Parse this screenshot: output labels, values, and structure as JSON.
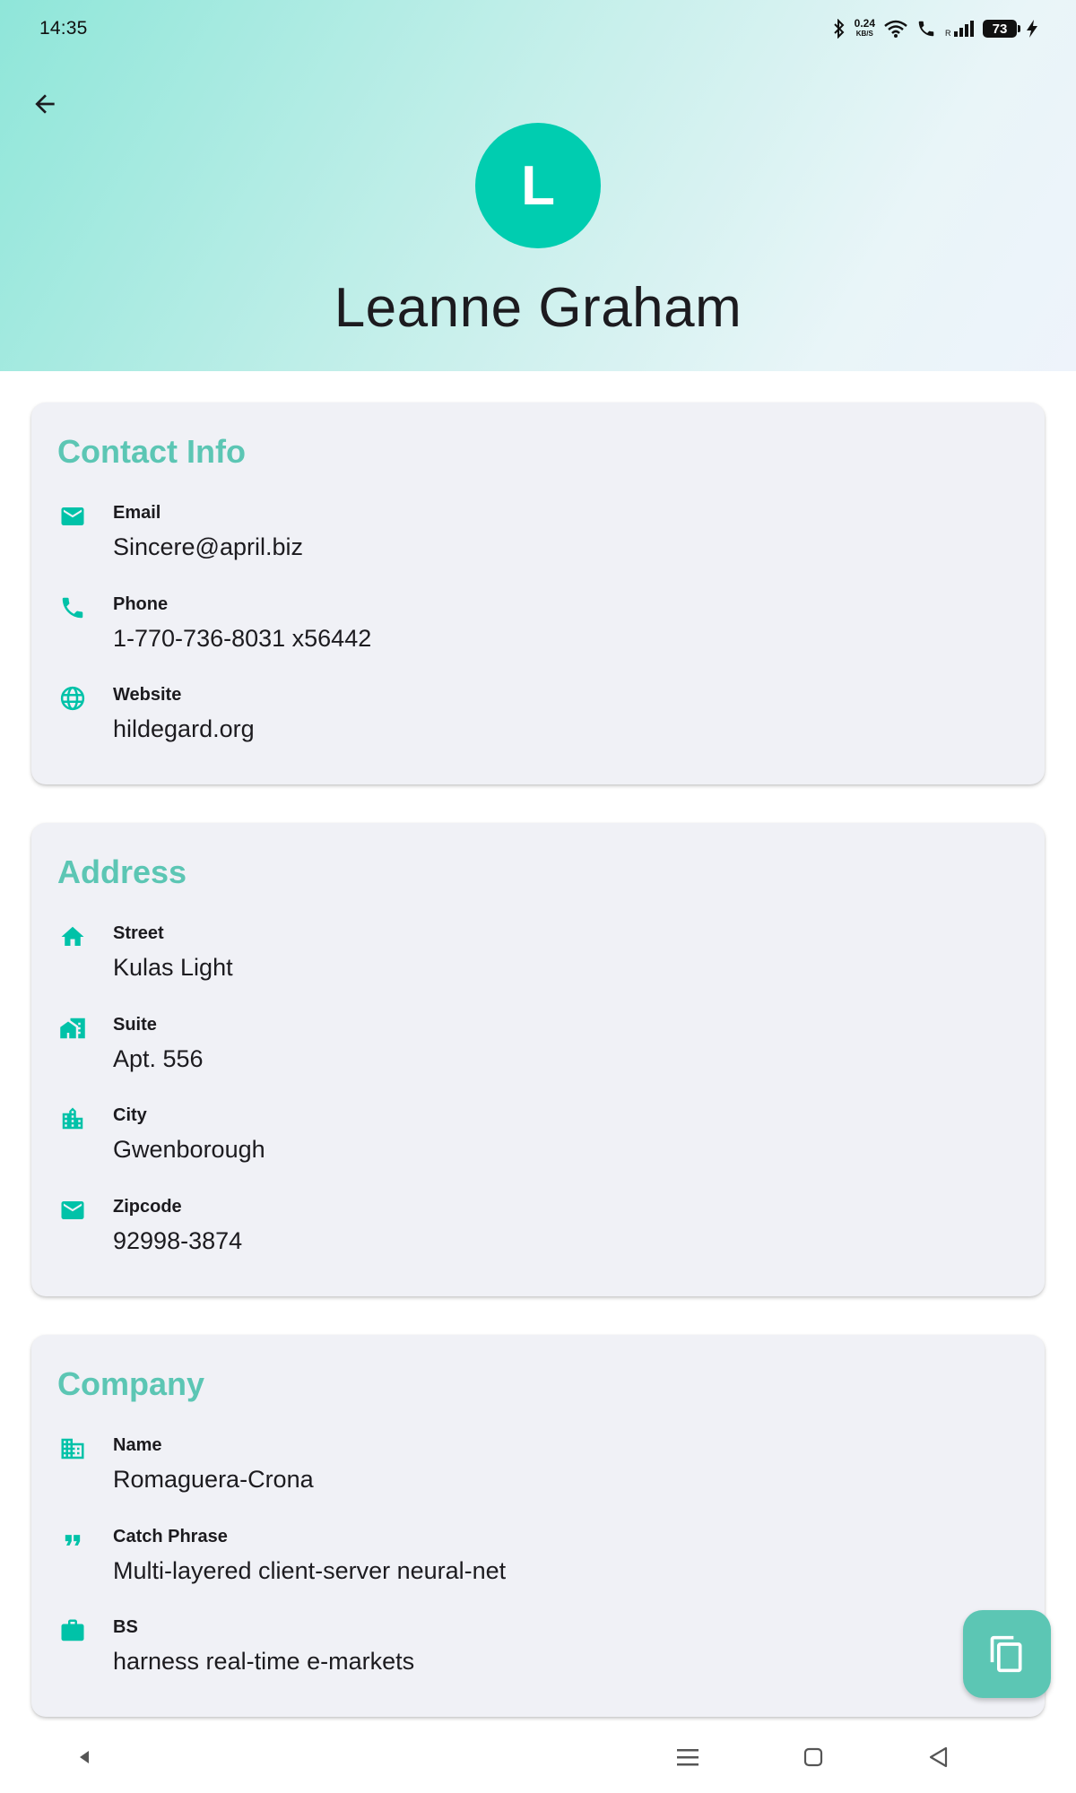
{
  "status_bar": {
    "time": "14:35",
    "net_speed_value": "0.24",
    "net_speed_unit": "KB/S",
    "battery": "73"
  },
  "profile": {
    "initial": "L",
    "name": "Leanne Graham"
  },
  "accent_color": "#5cc6b4",
  "avatar_color": "#00cdb0",
  "contact": {
    "title": "Contact Info",
    "fields": [
      {
        "icon": "email-icon",
        "label": "Email",
        "value": "Sincere@april.biz"
      },
      {
        "icon": "phone-icon",
        "label": "Phone",
        "value": "1-770-736-8031 x56442"
      },
      {
        "icon": "globe-icon",
        "label": "Website",
        "value": "hildegard.org"
      }
    ]
  },
  "address": {
    "title": "Address",
    "fields": [
      {
        "icon": "home-icon",
        "label": "Street",
        "value": "Kulas Light"
      },
      {
        "icon": "apartment-icon",
        "label": "Suite",
        "value": "Apt. 556"
      },
      {
        "icon": "city-icon",
        "label": "City",
        "value": "Gwenborough"
      },
      {
        "icon": "mail-icon",
        "label": "Zipcode",
        "value": "92998-3874"
      }
    ]
  },
  "company": {
    "title": "Company",
    "fields": [
      {
        "icon": "business-icon",
        "label": "Name",
        "value": "Romaguera-Crona"
      },
      {
        "icon": "quote-icon",
        "label": "Catch Phrase",
        "value": "Multi-layered client-server neural-net"
      },
      {
        "icon": "briefcase-icon",
        "label": "BS",
        "value": "harness real-time e-markets"
      }
    ]
  }
}
